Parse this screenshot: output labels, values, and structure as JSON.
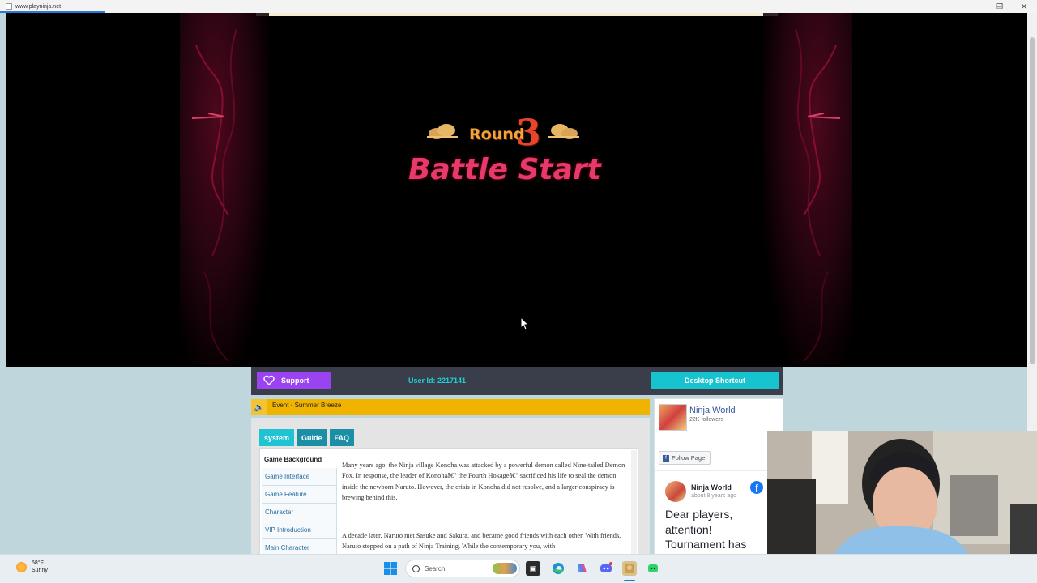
{
  "window": {
    "url": "www.playninja.net"
  },
  "game": {
    "round_label": "Round",
    "round_number": "3",
    "battle_text": "Battle Start"
  },
  "actionbar": {
    "support_label": "Support",
    "user_id": "User Id: 2217141",
    "desktop_label": "Desktop Shortcut"
  },
  "event": {
    "label": "Event - Summer Breeze"
  },
  "guide": {
    "tabs": [
      {
        "label": "system",
        "active": true
      },
      {
        "label": "Guide",
        "active": false
      },
      {
        "label": "FAQ",
        "active": false
      }
    ],
    "side_items": [
      "Game Background",
      "Game Interface",
      "Game Feature",
      "Character",
      "VIP Introduction",
      "Main Character"
    ],
    "paragraphs": [
      "Many years ago, the Ninja village Konoha was attacked by a powerful demon called Nine-tailed Demon Fox. In response, the leader of Konohaâ€\" the Fourth Hokageâ€\" sacrificed his life to seal the demon inside the newborn Naruto. However, the crisis in Konoha did not resolve, and a larger conspiracy is brewing behind this.",
      "A decade later, Naruto met Sasuke and Sakura, and became good friends with each other. With friends, Naruto stepped on a path of Ninja Training. While the contemporary you, with"
    ]
  },
  "facebook": {
    "page_name": "Ninja World",
    "followers": "22K followers",
    "follow_label": "Follow Page",
    "post_name": "Ninja World",
    "post_time": "about 8 years ago",
    "post_text": "Dear players, attention! Tournament has"
  },
  "taskbar": {
    "temperature": "58°F",
    "condition": "Sunny",
    "search_placeholder": "Search"
  },
  "colors": {
    "support": "#9b43f0",
    "desktop": "#18c3d0",
    "event": "#f0b400",
    "battle_text": "#e83a6a"
  }
}
